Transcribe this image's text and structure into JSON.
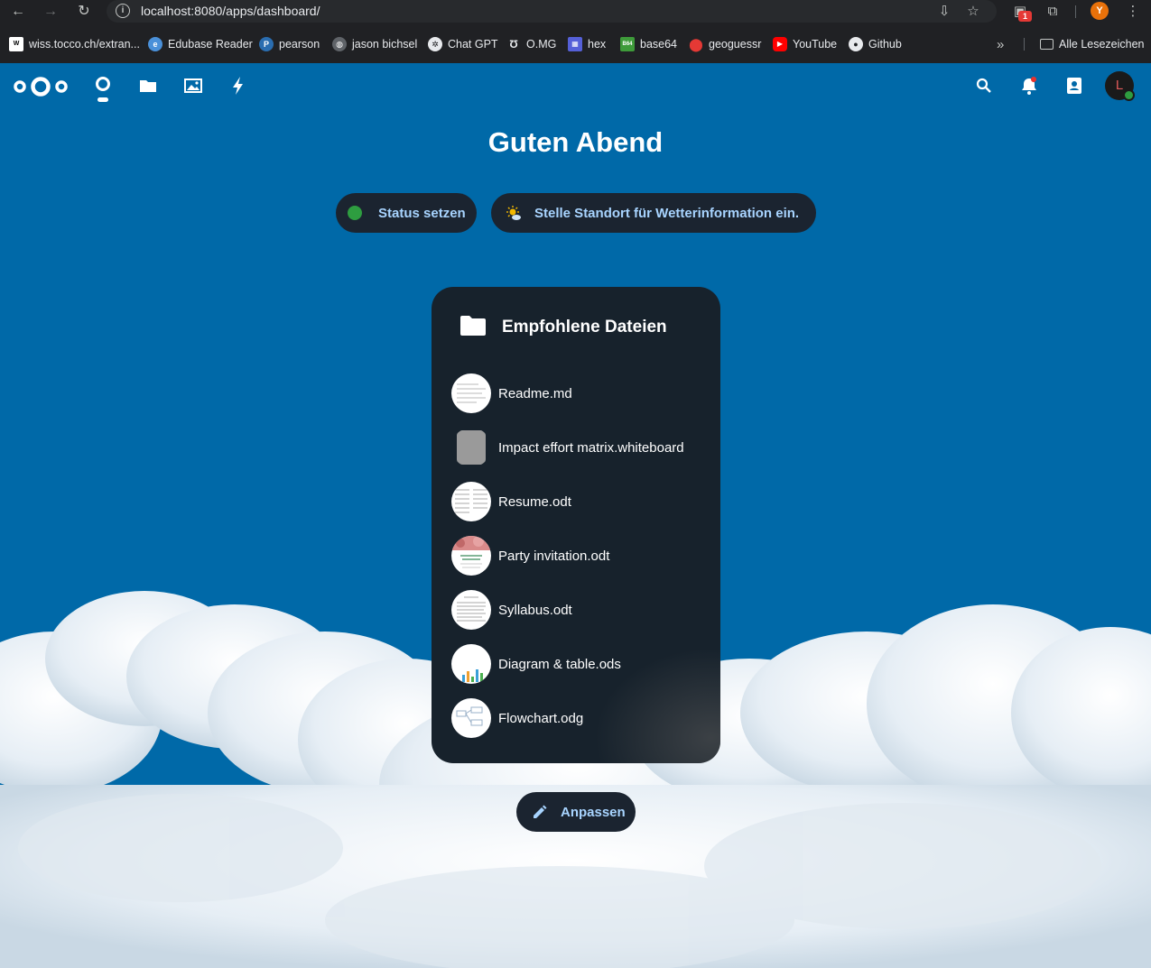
{
  "browser": {
    "url": "localhost:8080/apps/dashboard/",
    "extension_badge": "1",
    "profile_initial": "Y",
    "bookmarks": [
      {
        "label": "wiss.tocco.ch/extran...",
        "icon": "wiss-icon"
      },
      {
        "label": "Edubase Reader",
        "icon": "edubase-icon"
      },
      {
        "label": "pearson",
        "icon": "pearson-icon"
      },
      {
        "label": "jason bichsel",
        "icon": "globe-icon"
      },
      {
        "label": "Chat GPT",
        "icon": "chatgpt-icon"
      },
      {
        "label": "O.MG",
        "icon": "omg-icon"
      },
      {
        "label": "hex",
        "icon": "hex-icon"
      },
      {
        "label": "base64",
        "icon": "base64-icon"
      },
      {
        "label": "geoguessr",
        "icon": "map-pin-icon"
      },
      {
        "label": "YouTube",
        "icon": "youtube-icon"
      },
      {
        "label": "Github",
        "icon": "github-icon"
      }
    ],
    "all_bookmarks_label": "Alle Lesezeichen"
  },
  "header": {
    "avatar_initial": "L"
  },
  "dashboard": {
    "greeting": "Guten Abend",
    "status_button": "Status setzen",
    "weather_button": "Stelle Standort für Wetterinformation ein.",
    "customize_button": "Anpassen"
  },
  "widget": {
    "title": "Empfohlene Dateien",
    "files": [
      {
        "name": "Readme.md",
        "thumb": "document"
      },
      {
        "name": "Impact effort matrix.whiteboard",
        "thumb": "whiteboard"
      },
      {
        "name": "Resume.odt",
        "thumb": "document"
      },
      {
        "name": "Party invitation.odt",
        "thumb": "invitation"
      },
      {
        "name": "Syllabus.odt",
        "thumb": "document"
      },
      {
        "name": "Diagram & table.ods",
        "thumb": "spreadsheet"
      },
      {
        "name": "Flowchart.odg",
        "thumb": "drawing"
      }
    ]
  },
  "colors": {
    "background": "#0069a8",
    "panel": "#17222c",
    "accent_text": "#a8d4ff",
    "status_online": "#2e9d40"
  }
}
